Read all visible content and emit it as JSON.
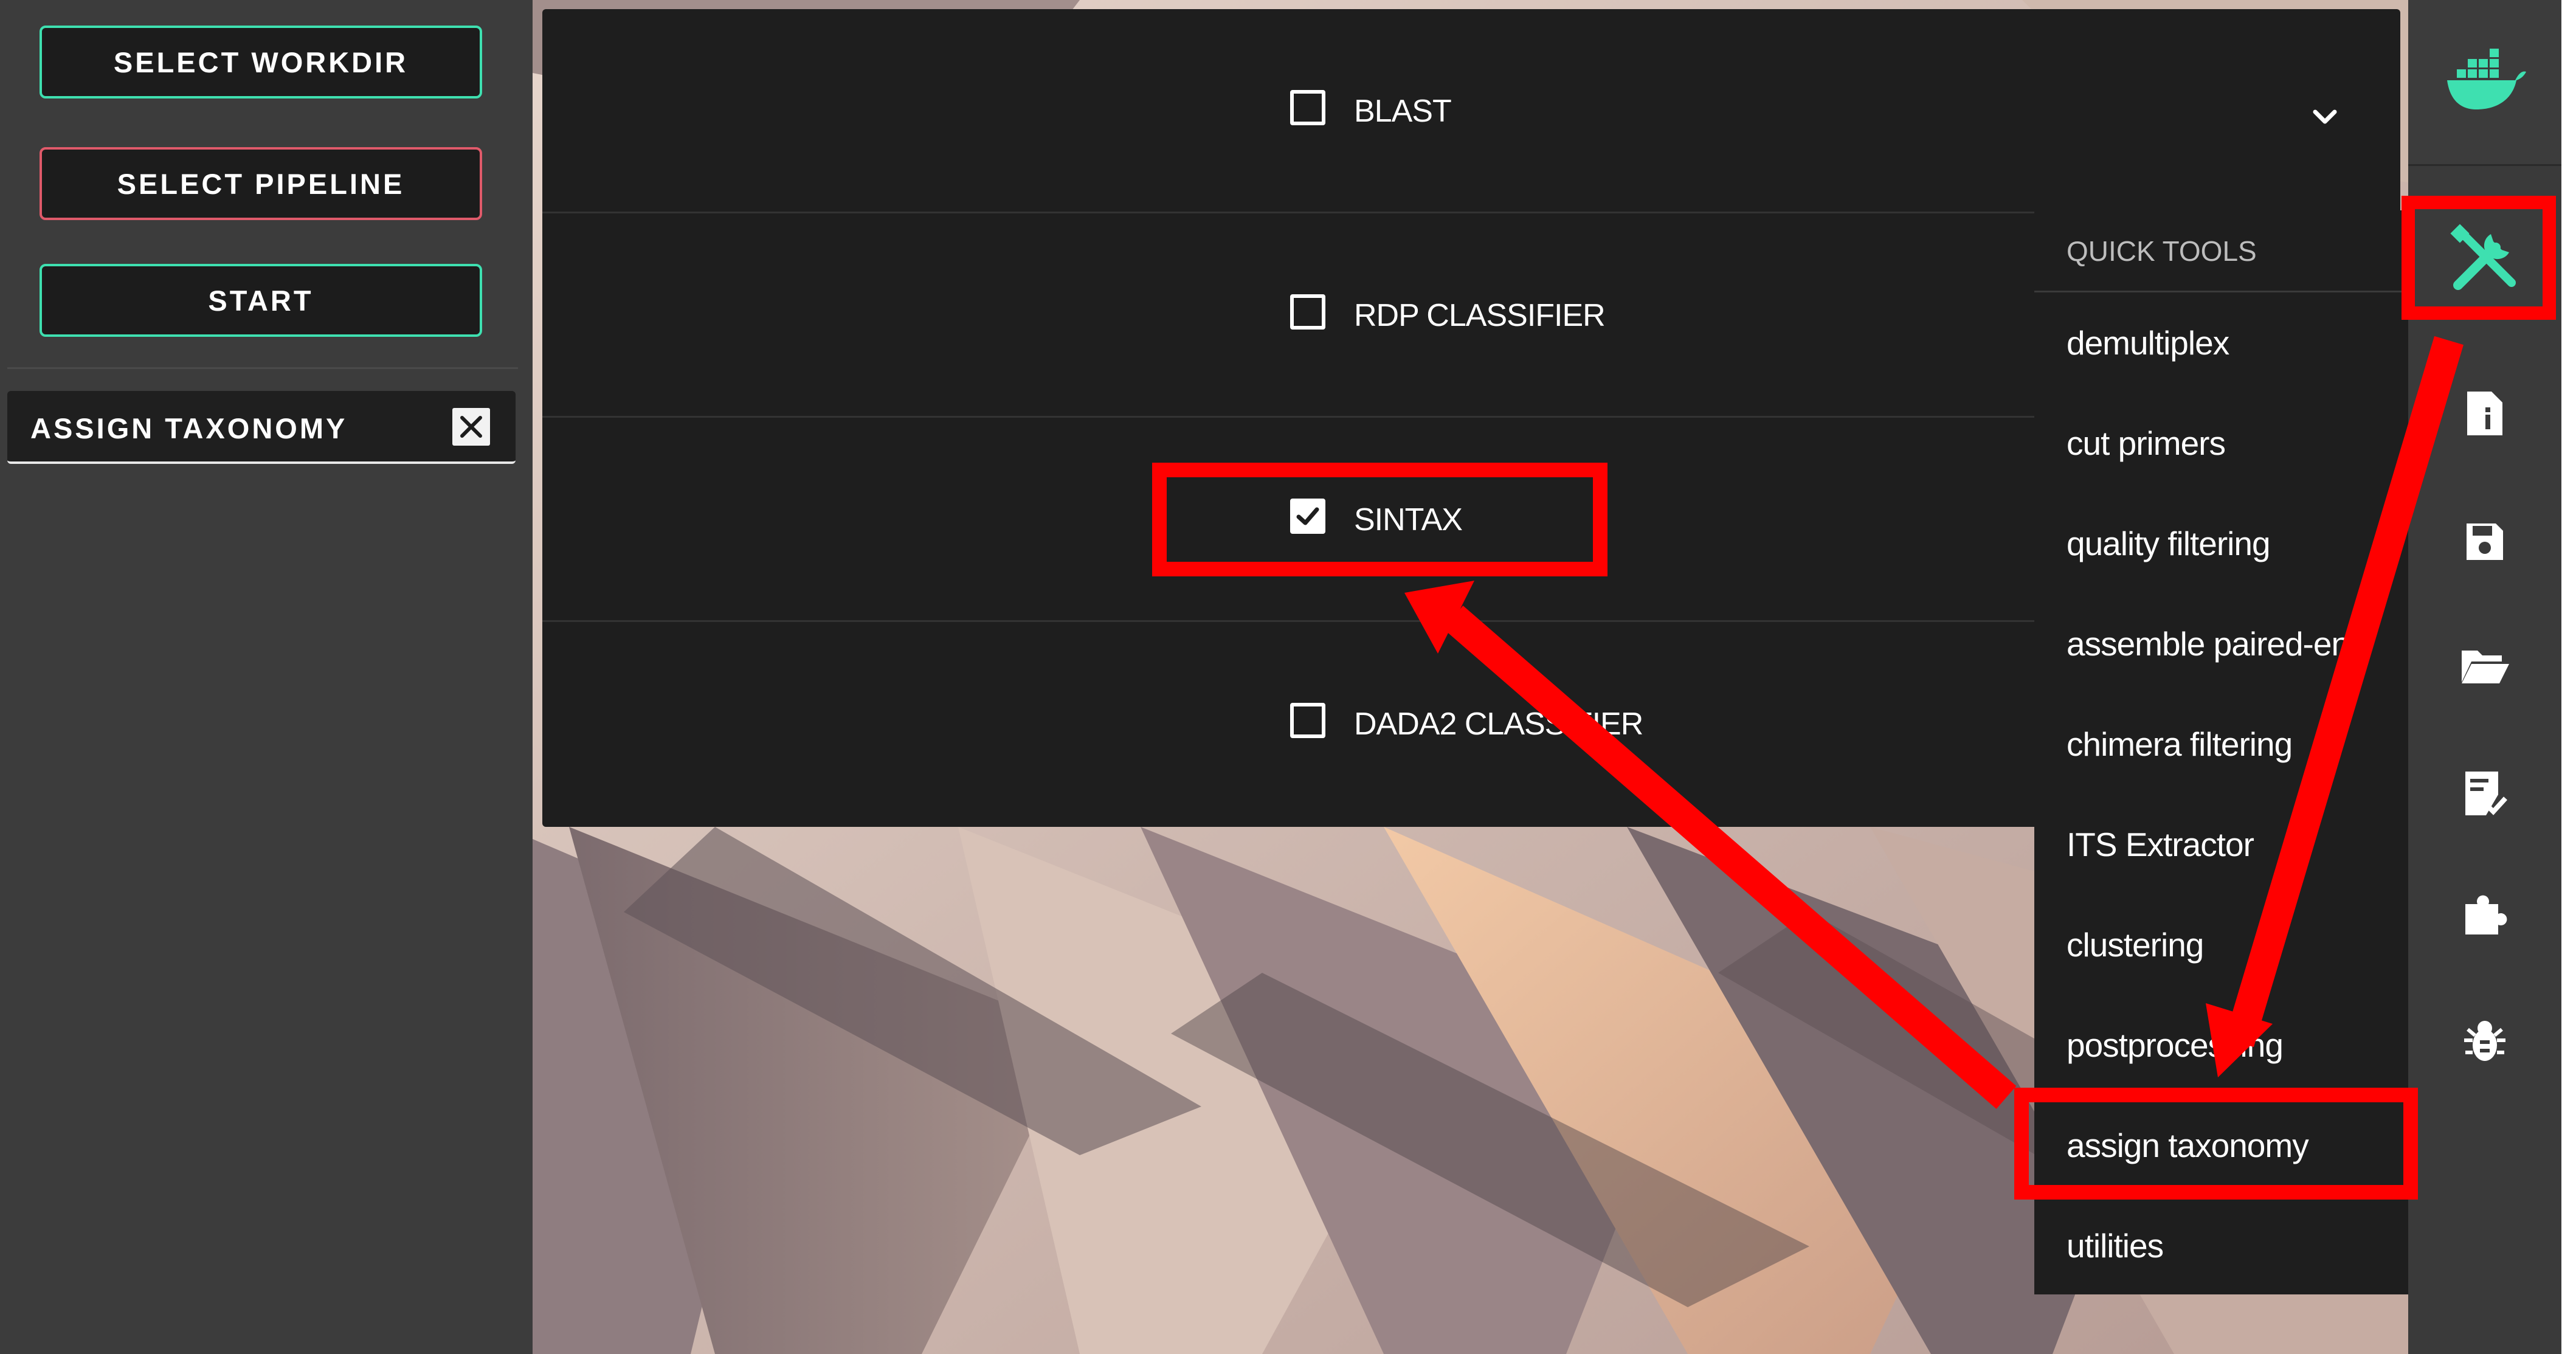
{
  "sidebar": {
    "select_workdir": "SELECT WORKDIR",
    "select_pipeline": "SELECT PIPELINE",
    "start": "START",
    "step_label": "ASSIGN TAXONOMY"
  },
  "options": [
    {
      "label": "BLAST",
      "checked": false
    },
    {
      "label": "RDP CLASSIFIER",
      "checked": false
    },
    {
      "label": "SINTAX",
      "checked": true
    },
    {
      "label": "DADA2 CLASSIFIER",
      "checked": false
    }
  ],
  "quick_tools": {
    "title": "QUICK TOOLS",
    "items": [
      "demultiplex",
      "cut primers",
      "quality filtering",
      "assemble paired-end",
      "chimera filtering",
      "ITS Extractor",
      "clustering",
      "postprocessing",
      "assign taxonomy",
      "utilities"
    ]
  },
  "toolbar_icons": [
    "docker-icon",
    "tools-icon",
    "file-info-icon",
    "save-icon",
    "folder-open-icon",
    "checklist-icon",
    "puzzle-icon",
    "bug-icon"
  ],
  "colors": {
    "accent": "#3ee0b0",
    "annotation": "#ff0000",
    "panel": "#1e1e1e",
    "sidebar": "#3c3c3c"
  }
}
